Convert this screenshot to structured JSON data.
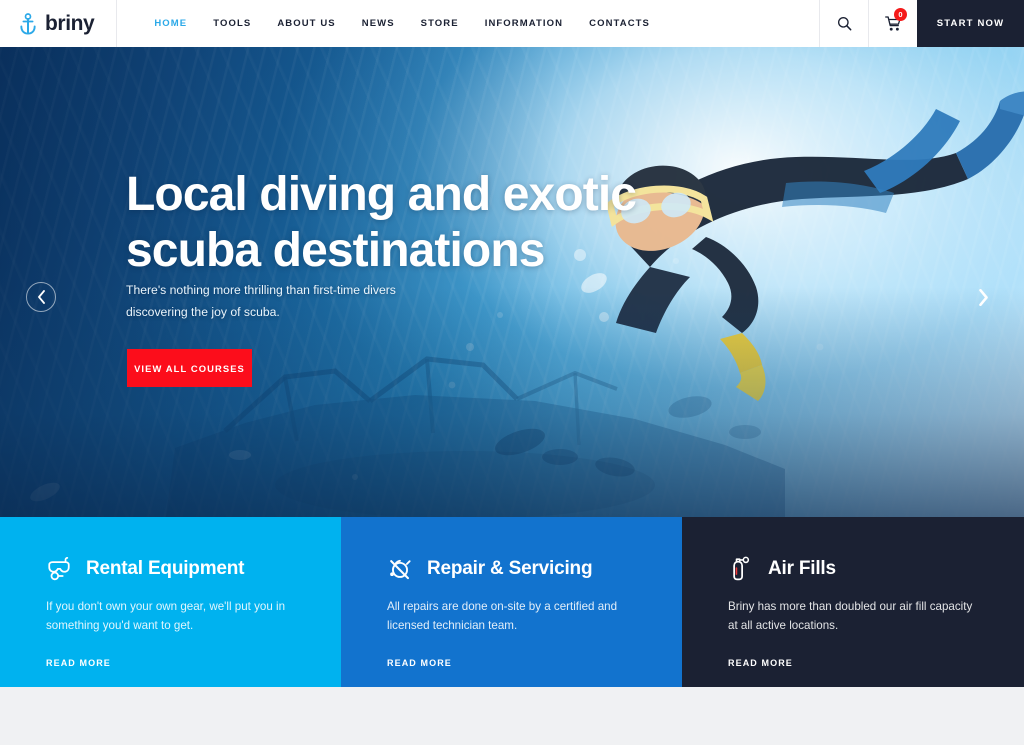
{
  "header": {
    "brand": {
      "name": "briny",
      "icon": "anchor-icon"
    },
    "nav": [
      {
        "label": "HOME",
        "active": true
      },
      {
        "label": "TOOLS",
        "active": false
      },
      {
        "label": "ABOUT US",
        "active": false
      },
      {
        "label": "NEWS",
        "active": false
      },
      {
        "label": "STORE",
        "active": false
      },
      {
        "label": "INFORMATION",
        "active": false
      },
      {
        "label": "CONTACTS",
        "active": false
      }
    ],
    "search_icon": "search-icon",
    "cart_icon": "cart-icon",
    "cart_badge": "0",
    "start_button": "START NOW",
    "accent_active": "#2ca9e8",
    "dark": "#1b2133"
  },
  "hero": {
    "title": "Local diving and exotic scuba destinations",
    "subtitle": "There's nothing more thrilling than first-time divers discovering the joy of scuba.",
    "cta_label": "VIEW ALL COURSES",
    "cta_color": "#fc0d1b",
    "prev_icon": "chevron-left-icon",
    "next_icon": "chevron-right-icon"
  },
  "features": [
    {
      "icon": "diving-mask-icon",
      "title": "Rental Equipment",
      "desc": "If you don't own your own gear, we'll put you in something you'd want to get.",
      "link": "READ MORE",
      "bg": "#00b2ef"
    },
    {
      "icon": "regulator-gauge-icon",
      "title": "Repair & Servicing",
      "desc": "All repairs are done on-site by a certified and licensed technician team.",
      "link": "READ MORE",
      "bg": "#1273ce"
    },
    {
      "icon": "air-tank-icon",
      "title": "Air Fills",
      "desc": "Briny has more than doubled our air fill capacity at all active locations.",
      "link": "READ MORE",
      "bg": "#1b2133"
    }
  ]
}
